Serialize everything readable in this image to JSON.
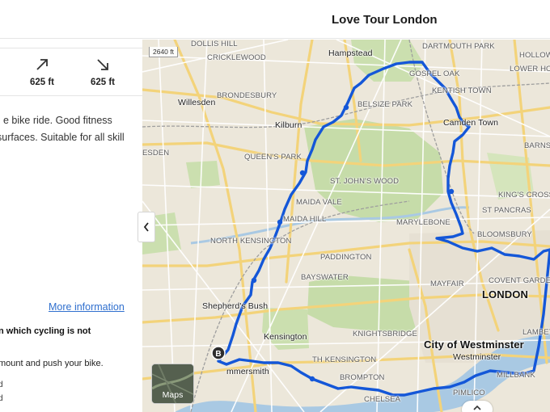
{
  "header": {
    "title": "Love Tour London"
  },
  "stats": {
    "ascent": {
      "icon": "arrow-up-right-icon",
      "value": "625 ft"
    },
    "descent": {
      "icon": "arrow-down-right-icon",
      "value": "625 ft"
    }
  },
  "description": {
    "line1": "e bike ride. Good fitness",
    "line2": "surfaces. Suitable for all skill"
  },
  "more_info_link": "More information",
  "warning": {
    "line1": "n which cycling is not",
    "line2": ""
  },
  "dismount_text": "mount and push your bike.",
  "tiny_lines": [
    "d",
    "d"
  ],
  "map": {
    "scale": "2640 ft",
    "start_marker": "B",
    "maps_button": "Maps",
    "route_color": "#1457d8",
    "labels": {
      "dollis_hill": "DOLLIS HILL",
      "cricklewood": "CRICKLEWOOD",
      "hampstead": "Hampstead",
      "dartmouth_park": "DARTMOUTH PARK",
      "holloway": "HOLLOW",
      "lower_holloway": "LOWER HO",
      "brondesbury": "BRONDESBURY",
      "willesden": "Willesden",
      "gospel_oak": "GOSPEL OAK",
      "kentish_town": "KENTISH TOWN",
      "belsize_park": "BELSIZE PARK",
      "kilburn": "Kilburn",
      "camden_town": "Camden Town",
      "barnsbury": "BARNS",
      "harlesden": "ESDEN",
      "queens_park": "QUEEN'S PARK",
      "st_johns_wood": "ST. JOHN'S WOOD",
      "kings_cross": "KING'S CROSS",
      "maida_vale": "MAIDA VALE",
      "st_pancras": "ST PANCRAS",
      "maida_hill": "MAIDA HILL",
      "marylebone": "MARYLEBONE",
      "north_kensington": "NORTH KENSINGTON",
      "bloomsbury": "BLOOMSBURY",
      "paddington": "PADDINGTON",
      "bayswater": "BAYSWATER",
      "covent_garden": "COVENT GARDE",
      "mayfair": "MAYFAIR",
      "london": "LONDON",
      "shepherds_bush": "Shepherd's Bush",
      "kensington": "Kensington",
      "knightsbridge": "KNIGHTSBRIDGE",
      "lambeth": "LAMBET",
      "city_of_westminster": "City of Westminster",
      "westminster": "Westminster",
      "hammersmith": "mmersmith",
      "south_kensington": "TH KENSINGTON",
      "brompton": "BROMPTON",
      "millbank": "MILLBANK",
      "chelsea": "CHELSEA",
      "pimlico": "PIMLICO"
    }
  }
}
